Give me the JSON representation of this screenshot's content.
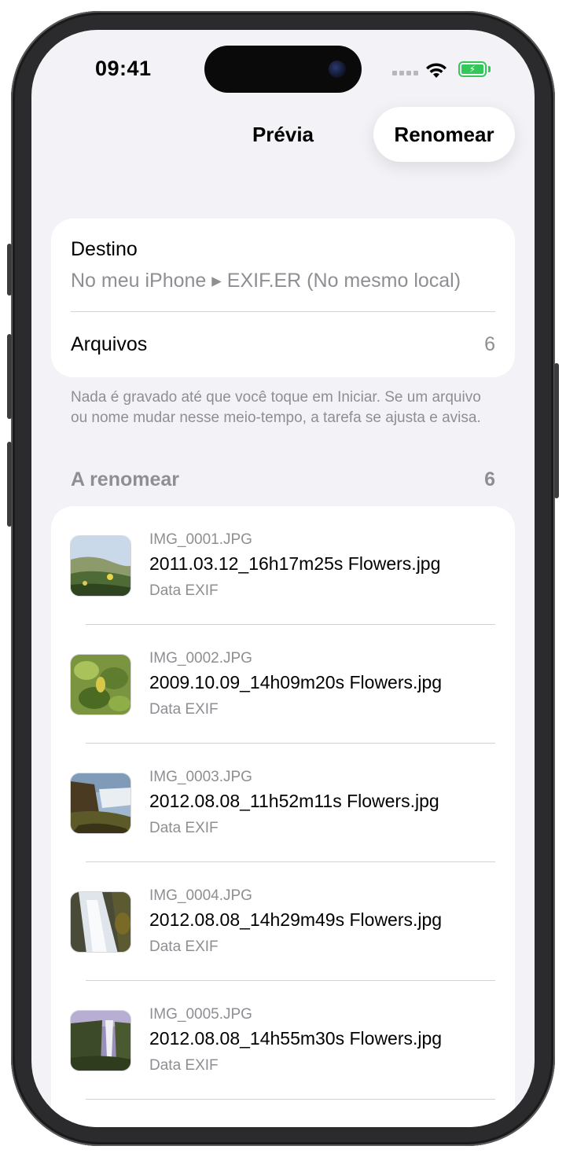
{
  "status_bar": {
    "time": "09:41"
  },
  "nav": {
    "title": "Prévia",
    "action_label": "Renomear"
  },
  "summary": {
    "destination_label": "Destino",
    "destination_value": "No meu iPhone ▸ EXIF.ER (No mesmo local)",
    "files_label": "Arquivos",
    "files_count": "6"
  },
  "footnote": "Nada é gravado até que você toque em Iniciar. Se um arquivo ou nome mudar nesse meio-tempo, a tarefa se ajusta e avisa.",
  "section": {
    "title": "A renomear",
    "count": "6"
  },
  "files": [
    {
      "original": "IMG_0001.JPG",
      "new_name": "2011.03.12_16h17m25s Flowers.jpg",
      "source": "Data EXIF"
    },
    {
      "original": "IMG_0002.JPG",
      "new_name": "2009.10.09_14h09m20s Flowers.jpg",
      "source": "Data EXIF"
    },
    {
      "original": "IMG_0003.JPG",
      "new_name": "2012.08.08_11h52m11s Flowers.jpg",
      "source": "Data EXIF"
    },
    {
      "original": "IMG_0004.JPG",
      "new_name": "2012.08.08_14h29m49s Flowers.jpg",
      "source": "Data EXIF"
    },
    {
      "original": "IMG_0005.JPG",
      "new_name": "2012.08.08_14h55m30s Flowers.jpg",
      "source": "Data EXIF"
    }
  ],
  "colors": {
    "background": "#f2f2f7",
    "card": "#ffffff",
    "secondary_text": "#8e8e93",
    "battery": "#34c759"
  }
}
